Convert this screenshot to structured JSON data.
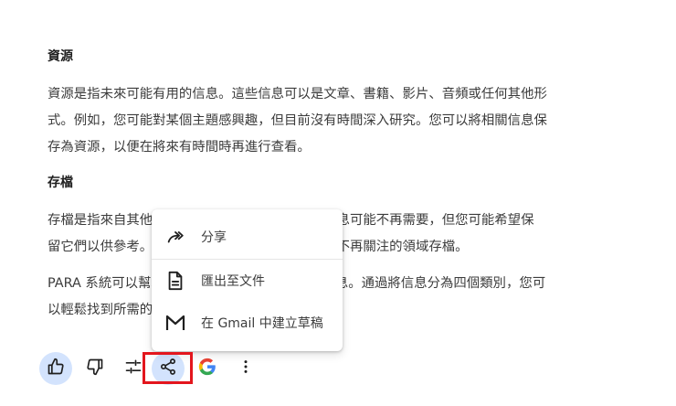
{
  "sections": [
    {
      "heading": "資源",
      "lines": [
        "資源是指未來可能有用的信息。這些信息可以是文章、書籍、影片、音頻或任何其他形",
        "式。例如，您可能對某個主題感興趣，但目前沒有時間深入研究。您可以將相關信息保",
        "存為資源，以便在將來有時間時再進行查看。"
      ]
    },
    {
      "heading": "存檔",
      "lines": [
        "存檔是指來自其他領域的非活動信息。雖然這些信息可能不再需要，但您可能希望保",
        "留它們以供參考。例如，您可以將已完成的項目和不再關注的領域存檔。"
      ]
    }
  ],
  "para_lines": [
    "PARA 系統可以幫助您更有效地整理和管理您的信息。通過將信息分為四個類別，您可",
    "以輕鬆找到所需的信息並專注於重要的事情。"
  ],
  "share_menu": {
    "items": [
      {
        "icon": "share-arrow-icon",
        "label": "分享"
      },
      {
        "icon": "document-icon",
        "label": "匯出至文件"
      },
      {
        "icon": "gmail-icon",
        "label": "在 Gmail 中建立草稿"
      }
    ]
  },
  "toolbar": {
    "buttons": [
      {
        "icon": "thumbs-up-icon"
      },
      {
        "icon": "thumbs-down-icon"
      },
      {
        "icon": "tune-icon"
      },
      {
        "icon": "share-icon"
      },
      {
        "icon": "google-icon"
      },
      {
        "icon": "more-vert-icon"
      }
    ]
  },
  "colors": {
    "accent_bg": "#d3e3fd",
    "highlight": "#e3161d",
    "text": "#1f1f1f",
    "body_text": "#3c3c3c"
  }
}
